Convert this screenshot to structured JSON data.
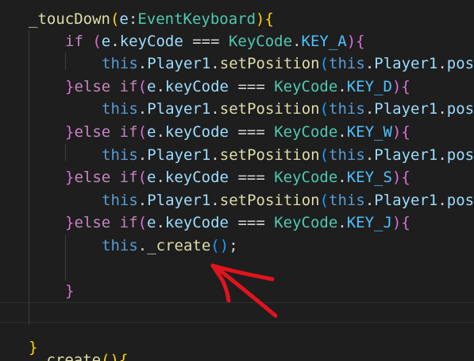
{
  "lines": [
    {
      "tokens": [
        {
          "t": "_toucDown",
          "c": "fn"
        },
        {
          "t": "(",
          "c": "brace"
        },
        {
          "t": "e",
          "c": "var"
        },
        {
          "t": ":",
          "c": "plain"
        },
        {
          "t": "EventKeyboard",
          "c": "type"
        },
        {
          "t": ")",
          "c": "brace"
        },
        {
          "t": "{",
          "c": "brace"
        }
      ]
    },
    {
      "tokens": [
        {
          "t": "if",
          "c": "kw"
        },
        {
          "t": " ",
          "c": "plain"
        },
        {
          "t": "(",
          "c": "paren"
        },
        {
          "t": "e",
          "c": "var"
        },
        {
          "t": ".",
          "c": "plain"
        },
        {
          "t": "keyCode",
          "c": "var"
        },
        {
          "t": " === ",
          "c": "plain"
        },
        {
          "t": "KeyCode",
          "c": "type"
        },
        {
          "t": ".",
          "c": "plain"
        },
        {
          "t": "KEY_A",
          "c": "const"
        },
        {
          "t": ")",
          "c": "paren"
        },
        {
          "t": "{",
          "c": "paren"
        }
      ]
    },
    {
      "tokens": [
        {
          "t": "this",
          "c": "this"
        },
        {
          "t": ".",
          "c": "plain"
        },
        {
          "t": "Player1",
          "c": "var"
        },
        {
          "t": ".",
          "c": "plain"
        },
        {
          "t": "setPosition",
          "c": "fn"
        },
        {
          "t": "(",
          "c": "paren2"
        },
        {
          "t": "this",
          "c": "this"
        },
        {
          "t": ".",
          "c": "plain"
        },
        {
          "t": "Player1",
          "c": "var"
        },
        {
          "t": ".",
          "c": "plain"
        },
        {
          "t": "pos",
          "c": "var"
        }
      ]
    },
    {
      "tokens": [
        {
          "t": "}",
          "c": "paren"
        },
        {
          "t": "else",
          "c": "kw"
        },
        {
          "t": " ",
          "c": "plain"
        },
        {
          "t": "if",
          "c": "kw"
        },
        {
          "t": "(",
          "c": "paren"
        },
        {
          "t": "e",
          "c": "var"
        },
        {
          "t": ".",
          "c": "plain"
        },
        {
          "t": "keyCode",
          "c": "var"
        },
        {
          "t": " === ",
          "c": "plain"
        },
        {
          "t": "KeyCode",
          "c": "type"
        },
        {
          "t": ".",
          "c": "plain"
        },
        {
          "t": "KEY_D",
          "c": "const"
        },
        {
          "t": ")",
          "c": "paren"
        },
        {
          "t": "{",
          "c": "paren"
        }
      ]
    },
    {
      "tokens": [
        {
          "t": "this",
          "c": "this"
        },
        {
          "t": ".",
          "c": "plain"
        },
        {
          "t": "Player1",
          "c": "var"
        },
        {
          "t": ".",
          "c": "plain"
        },
        {
          "t": "setPosition",
          "c": "fn"
        },
        {
          "t": "(",
          "c": "paren2"
        },
        {
          "t": "this",
          "c": "this"
        },
        {
          "t": ".",
          "c": "plain"
        },
        {
          "t": "Player1",
          "c": "var"
        },
        {
          "t": ".",
          "c": "plain"
        },
        {
          "t": "pos",
          "c": "var"
        }
      ]
    },
    {
      "tokens": [
        {
          "t": "}",
          "c": "paren"
        },
        {
          "t": "else",
          "c": "kw"
        },
        {
          "t": " ",
          "c": "plain"
        },
        {
          "t": "if",
          "c": "kw"
        },
        {
          "t": "(",
          "c": "paren"
        },
        {
          "t": "e",
          "c": "var"
        },
        {
          "t": ".",
          "c": "plain"
        },
        {
          "t": "keyCode",
          "c": "var"
        },
        {
          "t": " === ",
          "c": "plain"
        },
        {
          "t": "KeyCode",
          "c": "type"
        },
        {
          "t": ".",
          "c": "plain"
        },
        {
          "t": "KEY_W",
          "c": "const"
        },
        {
          "t": ")",
          "c": "paren"
        },
        {
          "t": "{",
          "c": "paren"
        }
      ]
    },
    {
      "tokens": [
        {
          "t": "this",
          "c": "this"
        },
        {
          "t": ".",
          "c": "plain"
        },
        {
          "t": "Player1",
          "c": "var"
        },
        {
          "t": ".",
          "c": "plain"
        },
        {
          "t": "setPosition",
          "c": "fn"
        },
        {
          "t": "(",
          "c": "paren2"
        },
        {
          "t": "this",
          "c": "this"
        },
        {
          "t": ".",
          "c": "plain"
        },
        {
          "t": "Player1",
          "c": "var"
        },
        {
          "t": ".",
          "c": "plain"
        },
        {
          "t": "pos",
          "c": "var"
        }
      ]
    },
    {
      "tokens": [
        {
          "t": "}",
          "c": "paren"
        },
        {
          "t": "else",
          "c": "kw"
        },
        {
          "t": " ",
          "c": "plain"
        },
        {
          "t": "if",
          "c": "kw"
        },
        {
          "t": "(",
          "c": "paren"
        },
        {
          "t": "e",
          "c": "var"
        },
        {
          "t": ".",
          "c": "plain"
        },
        {
          "t": "keyCode",
          "c": "var"
        },
        {
          "t": " === ",
          "c": "plain"
        },
        {
          "t": "KeyCode",
          "c": "type"
        },
        {
          "t": ".",
          "c": "plain"
        },
        {
          "t": "KEY_S",
          "c": "const"
        },
        {
          "t": ")",
          "c": "paren"
        },
        {
          "t": "{",
          "c": "paren"
        }
      ]
    },
    {
      "tokens": [
        {
          "t": "this",
          "c": "this"
        },
        {
          "t": ".",
          "c": "plain"
        },
        {
          "t": "Player1",
          "c": "var"
        },
        {
          "t": ".",
          "c": "plain"
        },
        {
          "t": "setPosition",
          "c": "fn"
        },
        {
          "t": "(",
          "c": "paren2"
        },
        {
          "t": "this",
          "c": "this"
        },
        {
          "t": ".",
          "c": "plain"
        },
        {
          "t": "Player1",
          "c": "var"
        },
        {
          "t": ".",
          "c": "plain"
        },
        {
          "t": "pos",
          "c": "var"
        }
      ]
    },
    {
      "tokens": [
        {
          "t": "}",
          "c": "paren"
        },
        {
          "t": "else",
          "c": "kw"
        },
        {
          "t": " ",
          "c": "plain"
        },
        {
          "t": "if",
          "c": "kw"
        },
        {
          "t": "(",
          "c": "paren"
        },
        {
          "t": "e",
          "c": "var"
        },
        {
          "t": ".",
          "c": "plain"
        },
        {
          "t": "keyCode",
          "c": "var"
        },
        {
          "t": " === ",
          "c": "plain"
        },
        {
          "t": "KeyCode",
          "c": "type"
        },
        {
          "t": ".",
          "c": "plain"
        },
        {
          "t": "KEY_J",
          "c": "const"
        },
        {
          "t": ")",
          "c": "paren"
        },
        {
          "t": "{",
          "c": "paren"
        }
      ]
    },
    {
      "tokens": [
        {
          "t": "this",
          "c": "this"
        },
        {
          "t": ".",
          "c": "plain"
        },
        {
          "t": "_create",
          "c": "fn"
        },
        {
          "t": "(",
          "c": "paren2"
        },
        {
          "t": ")",
          "c": "paren2"
        },
        {
          "t": ";",
          "c": "plain"
        }
      ]
    },
    {
      "tokens": []
    },
    {
      "tokens": [
        {
          "t": "}",
          "c": "paren"
        }
      ]
    },
    {
      "tokens": []
    },
    {
      "tokens": []
    },
    {
      "tokens": [
        {
          "t": "}",
          "c": "brace"
        }
      ]
    },
    {
      "tokens": [
        {
          "t": "_create",
          "c": "fn"
        },
        {
          "t": "(",
          "c": "brace"
        },
        {
          "t": ")",
          "c": "brace"
        },
        {
          "t": "{",
          "c": "brace"
        }
      ]
    }
  ],
  "annotation": {
    "shape": "hand-drawn-arrow",
    "color": "#e0141e",
    "points_to": "_create()"
  }
}
